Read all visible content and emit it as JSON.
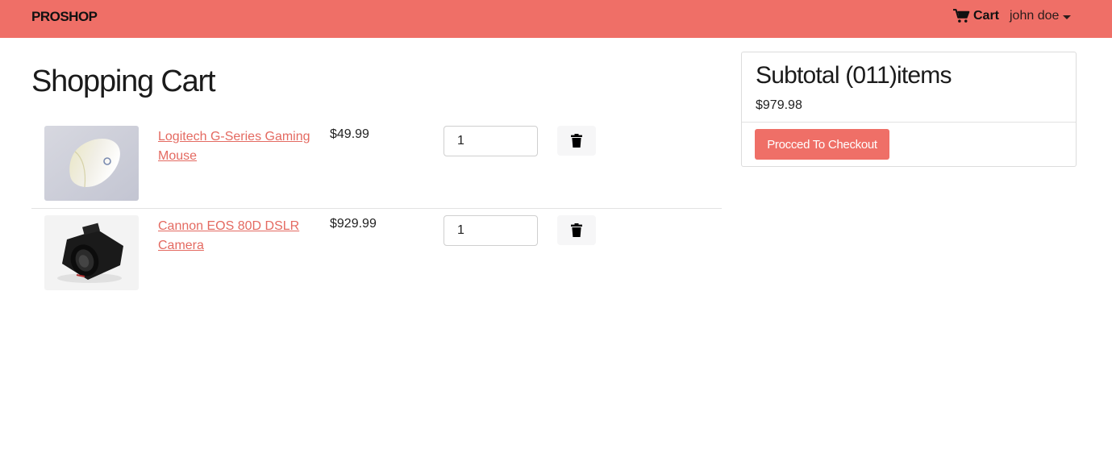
{
  "navbar": {
    "brand": "PROSHOP",
    "cart_label": "Cart",
    "cart_icon": "shopping-cart-icon",
    "user_name": "john doe",
    "colors": {
      "navbar_bg": "#ef6f67"
    }
  },
  "page": {
    "title": "Shopping Cart"
  },
  "cart": {
    "items": [
      {
        "name": "Logitech G-Series Gaming Mouse",
        "price": "$49.99",
        "qty": "1"
      },
      {
        "name": "Cannon EOS 80D DSLR Camera",
        "price": "$929.99",
        "qty": "1"
      }
    ],
    "delete_icon": "trash-icon"
  },
  "summary": {
    "title": "Subtotal (011)items",
    "total": "$979.98",
    "checkout_label": "Procced To Checkout",
    "colors": {
      "accent": "#ef6f67",
      "link": "#e46a61"
    }
  }
}
